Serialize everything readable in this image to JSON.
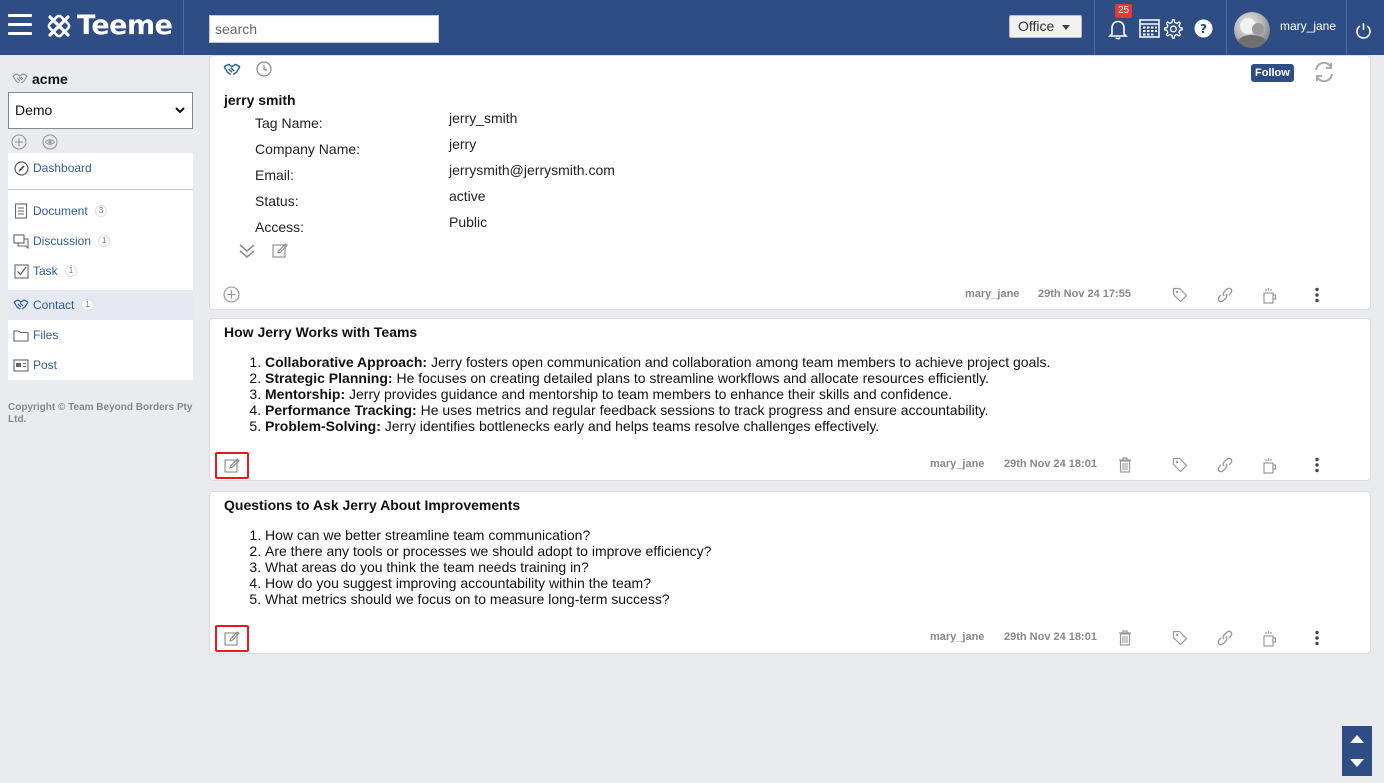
{
  "header": {
    "logo_text": "Teeme",
    "search_placeholder": "search",
    "office_label": "Office",
    "notification_count": "25",
    "username": "mary_jane"
  },
  "sidebar": {
    "org_name": "acme",
    "workspace_selected": "Demo",
    "items": [
      {
        "label": "Dashboard",
        "count": ""
      },
      {
        "label": "Document",
        "count": "3"
      },
      {
        "label": "Discussion",
        "count": "1"
      },
      {
        "label": "Task",
        "count": "1"
      },
      {
        "label": "Contact",
        "count": "1"
      },
      {
        "label": "Files",
        "count": ""
      },
      {
        "label": "Post",
        "count": ""
      }
    ],
    "copyright": "Copyright © Team Beyond Borders Pty Ltd."
  },
  "contact": {
    "name": "jerry smith",
    "follow_label": "Follow",
    "fields": [
      {
        "label": "Tag Name:",
        "value": "jerry_smith"
      },
      {
        "label": "Company Name:",
        "value": "jerry"
      },
      {
        "label": "Email:",
        "value": "jerrysmith@jerrysmith.com"
      },
      {
        "label": "Status:",
        "value": "active"
      },
      {
        "label": "Access:",
        "value": "Public"
      }
    ],
    "footer_user": "mary_jane",
    "footer_date": "29th Nov 24 17:55"
  },
  "posts": [
    {
      "title": "How Jerry Works with Teams",
      "items": [
        {
          "bold": "Collaborative Approach:",
          "text": " Jerry fosters open communication and collaboration among team members to achieve project goals."
        },
        {
          "bold": "Strategic Planning:",
          "text": " He focuses on creating detailed plans to streamline workflows and allocate resources efficiently."
        },
        {
          "bold": "Mentorship:",
          "text": " Jerry provides guidance and mentorship to team members to enhance their skills and confidence."
        },
        {
          "bold": "Performance Tracking:",
          "text": " He uses metrics and regular feedback sessions to track progress and ensure accountability."
        },
        {
          "bold": "Problem-Solving:",
          "text": " Jerry identifies bottlenecks early and helps teams resolve challenges effectively."
        }
      ],
      "footer_user": "mary_jane",
      "footer_date": "29th Nov 24 18:01"
    },
    {
      "title": "Questions to Ask Jerry About Improvements",
      "items": [
        {
          "bold": "",
          "text": "How can we better streamline team communication?"
        },
        {
          "bold": "",
          "text": "Are there any tools or processes we should adopt to improve efficiency?"
        },
        {
          "bold": "",
          "text": "What areas do you think the team needs training in?"
        },
        {
          "bold": "",
          "text": "How do you suggest improving accountability within the team?"
        },
        {
          "bold": "",
          "text": "What metrics should we focus on to measure long-term success?"
        }
      ],
      "footer_user": "mary_jane",
      "footer_date": "29th Nov 24 18:01"
    }
  ],
  "colors": {
    "header_bg": "#2e4d85",
    "highlight": "#e31b1b",
    "link": "#2e5c99"
  }
}
